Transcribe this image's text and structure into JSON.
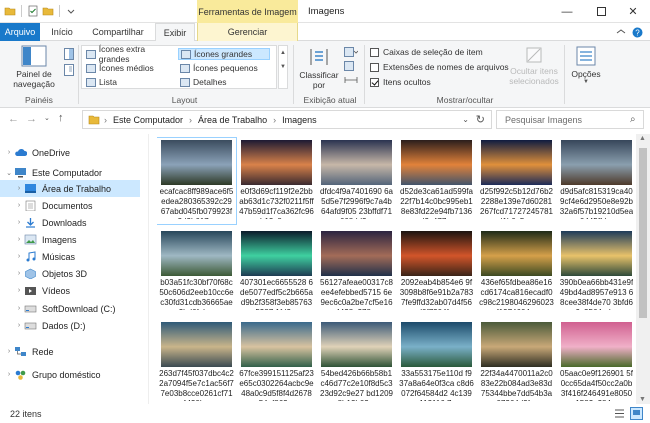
{
  "window": {
    "title": "Imagens",
    "context_tab": "Ferramentas de Imagem"
  },
  "tabs": [
    {
      "label": "Arquivo"
    },
    {
      "label": "Início"
    },
    {
      "label": "Compartilhar"
    },
    {
      "label": "Exibir"
    },
    {
      "label": "Gerenciar"
    }
  ],
  "ribbon": {
    "panes": {
      "nav_pane_label": "Painel de navegação",
      "group": "Painéis"
    },
    "layout": {
      "group": "Layout",
      "items": [
        "Ícones extra grandes",
        "Ícones grandes",
        "Ícones médios",
        "Ícones pequenos",
        "Lista",
        "Detalhes"
      ]
    },
    "current_view": {
      "sort_label": "Classificar por",
      "group": "Exibição atual"
    },
    "show_hide": {
      "group": "Mostrar/ocultar",
      "checkboxes": [
        {
          "label": "Caixas de seleção de item",
          "checked": false
        },
        {
          "label": "Extensões de nomes de arquivos",
          "checked": false
        },
        {
          "label": "Itens ocultos",
          "checked": true
        }
      ],
      "hide_selected_label": "Ocultar itens selecionados"
    },
    "options_label": "Opções"
  },
  "address": {
    "crumbs": [
      "Este Computador",
      "Área de Trabalho",
      "Imagens"
    ],
    "search_placeholder": "Pesquisar Imagens"
  },
  "nav": [
    {
      "label": "OneDrive",
      "indent": 0,
      "arrow": "›",
      "icon": "cloud"
    },
    {
      "label": "Este Computador",
      "indent": 0,
      "arrow": "⌄",
      "icon": "pc"
    },
    {
      "label": "Área de Trabalho",
      "indent": 1,
      "arrow": "›",
      "icon": "desktop",
      "selected": true
    },
    {
      "label": "Documentos",
      "indent": 1,
      "arrow": "›",
      "icon": "docs"
    },
    {
      "label": "Downloads",
      "indent": 1,
      "arrow": "›",
      "icon": "download"
    },
    {
      "label": "Imagens",
      "indent": 1,
      "arrow": "›",
      "icon": "images"
    },
    {
      "label": "Músicas",
      "indent": 1,
      "arrow": "›",
      "icon": "music"
    },
    {
      "label": "Objetos 3D",
      "indent": 1,
      "arrow": "›",
      "icon": "3d"
    },
    {
      "label": "Vídeos",
      "indent": 1,
      "arrow": "›",
      "icon": "video"
    },
    {
      "label": "SoftDownload (C:)",
      "indent": 1,
      "arrow": "›",
      "icon": "drive"
    },
    {
      "label": "Dados (D:)",
      "indent": 1,
      "arrow": "›",
      "icon": "drive"
    },
    {
      "label": "Rede",
      "indent": 0,
      "arrow": "›",
      "icon": "network"
    },
    {
      "label": "Grupo doméstico",
      "indent": 0,
      "arrow": "›",
      "icon": "homegroup"
    }
  ],
  "files": [
    {
      "name": "ecafcac8ff989ace6f5edea280365392c2967abd045fb079923f3d2b617...",
      "colors": [
        "#3b4c5e",
        "#8ba2b8",
        "#2e3a26"
      ]
    },
    {
      "name": "e0f3d69cf119f2e2bbab63d1c732f0211f5ff47b59d1f7ca362fc96b13c8a...",
      "colors": [
        "#1d1a33",
        "#d9824a",
        "#3a2a30"
      ]
    },
    {
      "name": "dfdc4f9a7401690 6a5d5e7f2996f9c7a4b64afd9f05 23bffdf71668dd2...",
      "colors": [
        "#2a3350",
        "#c7b7a8",
        "#54657a"
      ]
    },
    {
      "name": "d52de3ca61ad599fa22f7b14c0bc995eb18e83fd22e94fb7136d2c477...",
      "colors": [
        "#2b1e1c",
        "#e2823a",
        "#42546b"
      ]
    },
    {
      "name": "d25f992c5b12d76b22288e139e7d60281267fcd71727245781d1b0c5c...",
      "colors": [
        "#0f1c40",
        "#e0903b",
        "#1c2b58"
      ]
    },
    {
      "name": "d9d5afc815319ca409cf4e6d2950e8e92b32a6f57b19210d5ea0445ffd...",
      "colors": [
        "#37465a",
        "#8a9fae",
        "#4d3a2a"
      ]
    },
    {
      "name": "b03a51fc30bf70f68c50c606d2eeb10cc6ec30fd31cdb36665ae3bd6fab...",
      "colors": [
        "#27465a",
        "#9fb8c3",
        "#3d5a36"
      ]
    },
    {
      "name": "407301ec6655528 6de5077edf5c2b665ad9b2f358f3eb857635387 1fd2...",
      "colors": [
        "#0b1a2a",
        "#3fd0a0",
        "#1e3b52"
      ]
    },
    {
      "name": "56127afeae00317c8ee4efebbed5715 6e9ec6c0a2be7cf5e164428a378...",
      "colors": [
        "#2b2440",
        "#a36c58",
        "#20304a"
      ]
    },
    {
      "name": "2092eab4b854e6 9f3098b8f6e91b2a7837fe9ffd32ab07d4f56d0f7304f...",
      "colors": [
        "#1b1410",
        "#d2552a",
        "#3a2418"
      ]
    },
    {
      "name": "436ef65fdbea86e16cd6174ca816ecadf0c98c2198046296023f1974604...",
      "colors": [
        "#1e2a18",
        "#d5a04a",
        "#3c4a22"
      ]
    },
    {
      "name": "390b0ea66bb431e9f49bd4ad8957e913 68cee38f4de70 3bfd69c3564ed...",
      "colors": [
        "#1d3b5a",
        "#e8c26a",
        "#2e4a3a"
      ]
    },
    {
      "name": "263d7f45f037dbc4c22a7094f5e7c1ac56f77e03b8cce0261cf714420b...",
      "colors": [
        "#2f5a78",
        "#c9b58a",
        "#3a4a52"
      ]
    },
    {
      "name": "67fce399151125af23e65c0302264acbc9e48a0c9d5f8f4d267854ef862...",
      "colors": [
        "#3a6a8c",
        "#d8c3a0",
        "#31604a"
      ]
    },
    {
      "name": "54bed426b66b58b1c46d77c2e10f8d5c323d92c9e27 bd12098b13b02...",
      "colors": [
        "#3c5a78",
        "#e0d2b8",
        "#2e5236"
      ]
    },
    {
      "name": "33a553175e110d f937a8a64e0f3ca c8d6072f64584d2 4c139a112116 7...",
      "colors": [
        "#1c4a6a",
        "#7ab0c8",
        "#2a5a3a"
      ]
    },
    {
      "name": "22f34a4470011a2c083e22b084ad3e83d75344bbe7dd54b3a07264d2f...",
      "colors": [
        "#4a5a3a",
        "#c8a878",
        "#2e2e22"
      ]
    },
    {
      "name": "05aac0e9f126901 5f0cc65da4f50cc2a0b3f416f246491e80501582a284...",
      "colors": [
        "#d06090",
        "#f0b0c8",
        "#4a6a2a"
      ]
    }
  ],
  "status": {
    "count": "22 itens"
  },
  "colors": {
    "accent": "#1979ca",
    "selection": "#cce8ff",
    "context_tab_bg": "#f9ea9b"
  }
}
